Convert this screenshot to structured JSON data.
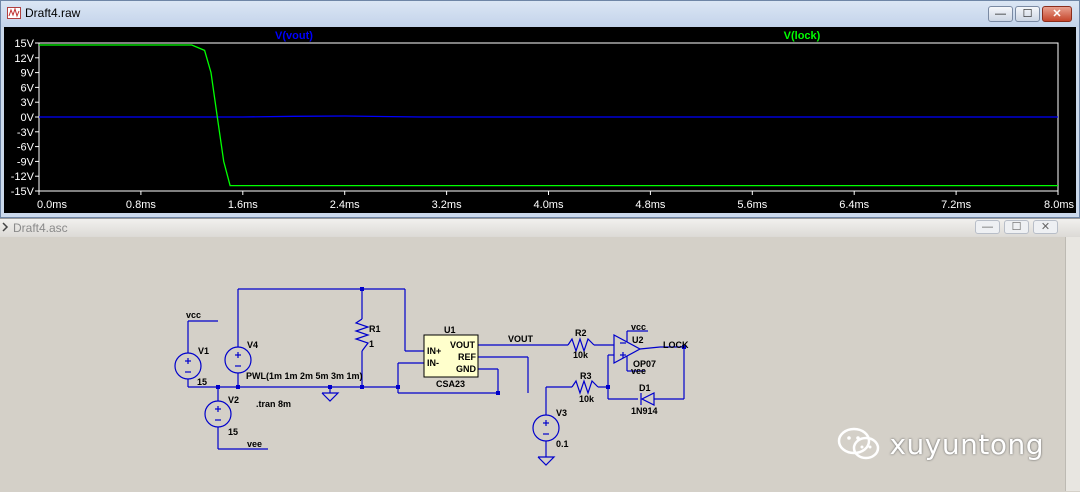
{
  "waveform_window": {
    "title": "Draft4.raw",
    "controls": {
      "minimize": "—",
      "maximize": "☐",
      "close": "✕"
    },
    "colors": {
      "background": "#000000",
      "vout": "#0000ff",
      "lock": "#00ff00",
      "axis_text": "#ffffff"
    },
    "traces": [
      {
        "label": "V(vout)",
        "color": "#0000ff"
      },
      {
        "label": "V(lock)",
        "color": "#00ff00"
      }
    ],
    "y_ticks": [
      "15V",
      "12V",
      "9V",
      "6V",
      "3V",
      "0V",
      "-3V",
      "-6V",
      "-9V",
      "-12V",
      "-15V"
    ],
    "x_ticks": [
      "0.0ms",
      "0.8ms",
      "1.6ms",
      "2.4ms",
      "3.2ms",
      "4.0ms",
      "4.8ms",
      "5.6ms",
      "6.4ms",
      "7.2ms",
      "8.0ms"
    ]
  },
  "chart_data": {
    "type": "line",
    "xlabel": "",
    "ylabel": "",
    "xlim": [
      0,
      8.0
    ],
    "ylim": [
      -15,
      15
    ],
    "grid": false,
    "series": [
      {
        "name": "V(vout)",
        "color": "#0000ff",
        "x": [
          0,
          1.6,
          2.0,
          2.4,
          3.0,
          8.0
        ],
        "y": [
          0,
          0,
          0.15,
          0.2,
          0,
          0
        ]
      },
      {
        "name": "V(lock)",
        "color": "#00ff00",
        "x": [
          0,
          1.2,
          1.3,
          1.35,
          1.4,
          1.45,
          1.5,
          8.0
        ],
        "y": [
          14.6,
          14.6,
          13.5,
          9,
          0,
          -9,
          -13.9,
          -13.9
        ]
      }
    ]
  },
  "schematic_window": {
    "title": "Draft4.asc",
    "controls": {
      "minimize": "—",
      "maximize": "☐",
      "close": "✕"
    },
    "labels": {
      "vcc1": "vcc",
      "v1": "V1",
      "v1_value": "15",
      "v4": "V4",
      "v4_value": "PWL(1m 1m 2m 5m 3m 1m)",
      "v2": "V2",
      "v2_value": "15",
      "vee1": "vee",
      "tran": ".tran 8m",
      "r1": "R1",
      "r1_value": "1",
      "u1": "U1",
      "u1_in_plus": "IN+",
      "u1_in_minus": "IN-",
      "u1_vout": "VOUT",
      "u1_ref": "REF",
      "u1_gnd": "GND",
      "u1_model": "CSA23",
      "vout_net": "VOUT",
      "r2": "R2",
      "r2_value": "10k",
      "r3": "R3",
      "r3_value": "10k",
      "v3": "V3",
      "v3_value": "0.1",
      "vcc2": "vcc",
      "u2": "U2",
      "u2_model": "OP07",
      "vee2": "vee",
      "lock_net": "LOCK",
      "d1": "D1",
      "d1_model": "1N914"
    }
  },
  "watermark": {
    "text": "xuyuntong",
    "icon": "wechat-icon"
  }
}
